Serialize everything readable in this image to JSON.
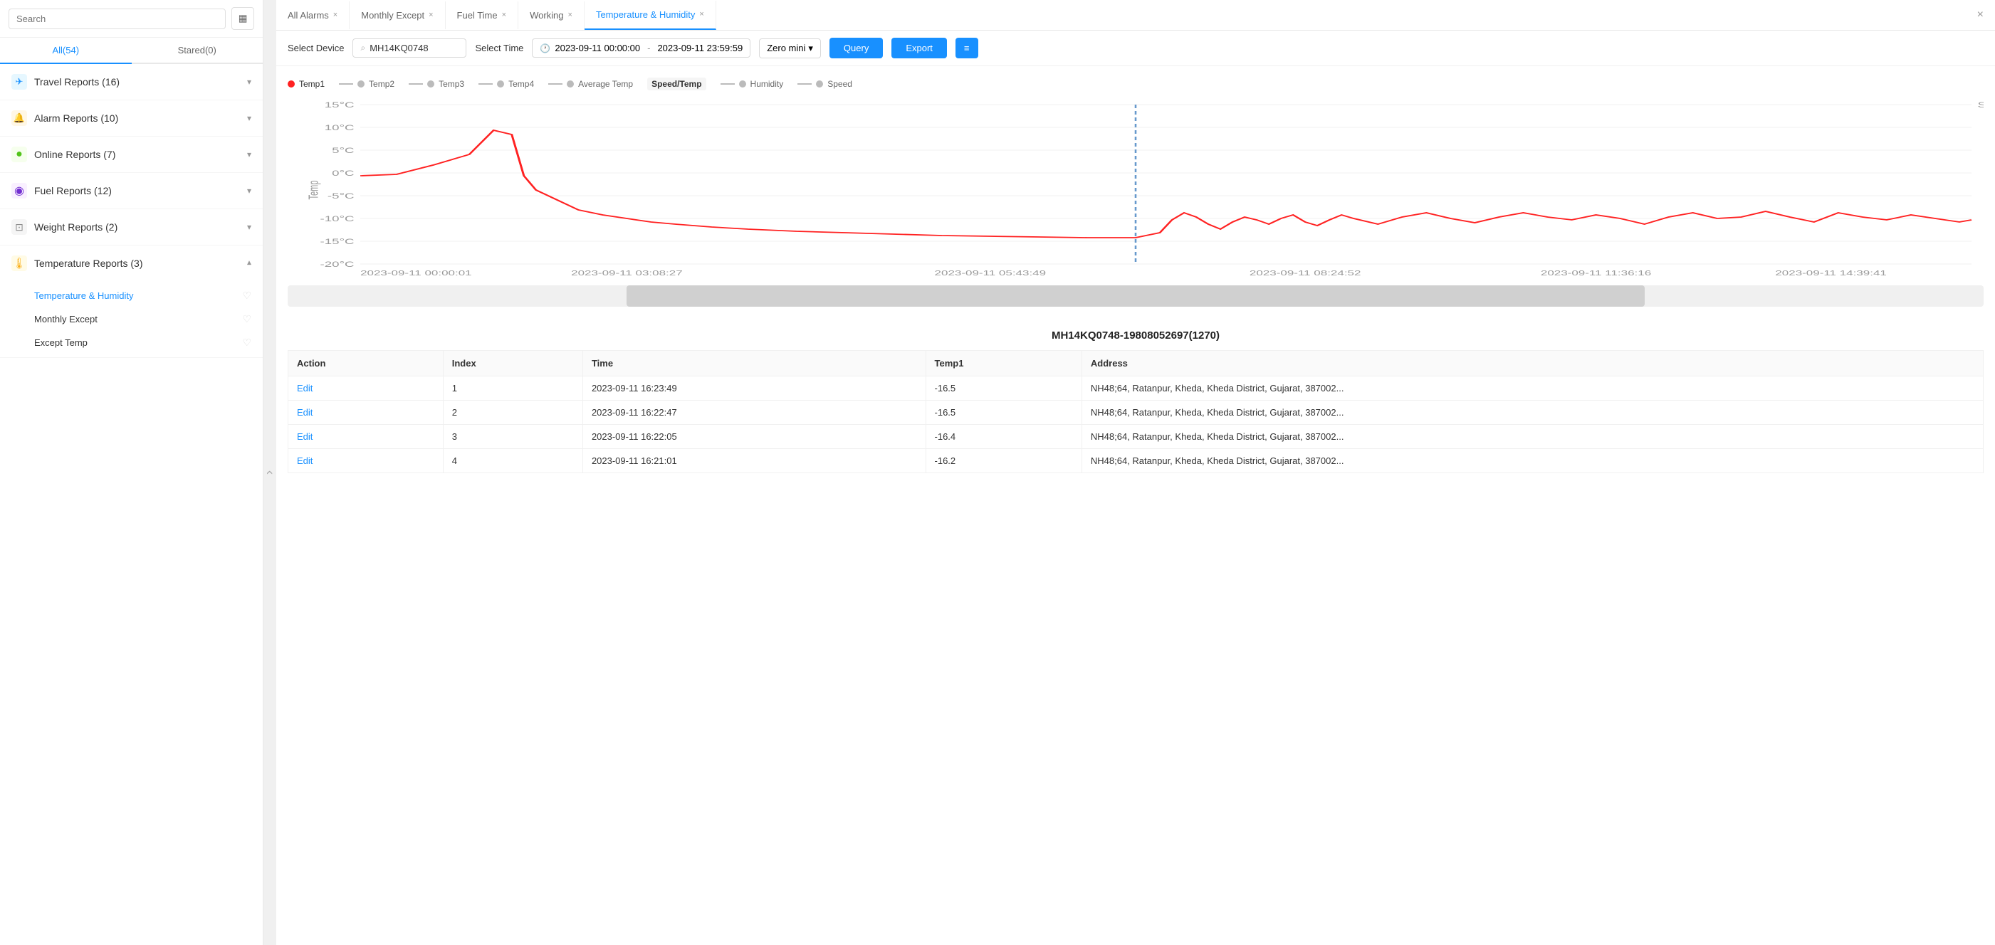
{
  "sidebar": {
    "search_placeholder": "Search",
    "tabs": [
      {
        "id": "all",
        "label": "All(54)",
        "active": true
      },
      {
        "id": "stared",
        "label": "Stared(0)",
        "active": false
      }
    ],
    "categories": [
      {
        "id": "travel",
        "icon": "✈",
        "icon_class": "blue",
        "label": "Travel Reports (16)",
        "expanded": false,
        "items": []
      },
      {
        "id": "alarm",
        "icon": "🔔",
        "icon_class": "orange",
        "label": "Alarm Reports (10)",
        "expanded": false,
        "items": []
      },
      {
        "id": "online",
        "icon": "○",
        "icon_class": "green",
        "label": "Online Reports (7)",
        "expanded": false,
        "items": []
      },
      {
        "id": "fuel",
        "icon": "◉",
        "icon_class": "purple",
        "label": "Fuel Reports (12)",
        "expanded": false,
        "items": []
      },
      {
        "id": "weight",
        "icon": "⊡",
        "icon_class": "gray",
        "label": "Weight Reports (2)",
        "expanded": false,
        "items": []
      },
      {
        "id": "temperature",
        "icon": "🌡",
        "icon_class": "yellow",
        "label": "Temperature Reports (3)",
        "expanded": true,
        "items": [
          {
            "id": "temp-humidity",
            "label": "Temperature & Humidity",
            "active": true
          },
          {
            "id": "monthly-except",
            "label": "Monthly Except",
            "active": false
          },
          {
            "id": "except-temp",
            "label": "Except Temp",
            "active": false
          }
        ]
      }
    ]
  },
  "tabs": [
    {
      "id": "all-alarms",
      "label": "All Alarms",
      "active": false,
      "closable": true
    },
    {
      "id": "monthly-except",
      "label": "Monthly Except",
      "active": false,
      "closable": true
    },
    {
      "id": "fuel-time",
      "label": "Fuel Time",
      "active": false,
      "closable": true
    },
    {
      "id": "working",
      "label": "Working",
      "active": false,
      "closable": true
    },
    {
      "id": "temp-humidity",
      "label": "Temperature & Humidity",
      "active": true,
      "closable": true
    }
  ],
  "toolbar": {
    "select_device_label": "Select Device",
    "device_value": "MH14KQ0748",
    "select_time_label": "Select Time",
    "time_start": "2023-09-11 00:00:00",
    "time_end": "2023-09-11 23:59:59",
    "zero_mini_label": "Zero mini",
    "query_label": "Query",
    "export_label": "Export"
  },
  "chart": {
    "legend": [
      {
        "label": "Temp1",
        "color": "#ff2222",
        "active": true
      },
      {
        "label": "Temp2",
        "color": "#aaa"
      },
      {
        "label": "Temp3",
        "color": "#aaa"
      },
      {
        "label": "Temp4",
        "color": "#aaa"
      },
      {
        "label": "Average Temp",
        "color": "#aaa"
      },
      {
        "label": "Speed/Temp",
        "active": true,
        "highlight": true
      },
      {
        "label": "Humidity",
        "color": "#aaa"
      },
      {
        "label": "Speed",
        "color": "#aaa"
      }
    ],
    "y_axis": [
      "15°C",
      "10°C",
      "5°C",
      "0°C",
      "-5°C",
      "-10°C",
      "-15°C",
      "-20°C"
    ],
    "y_axis_right": "Speed",
    "x_axis": [
      "2023-09-11 00:00:01",
      "2023-09-11 03:08:27",
      "2023-09-11 05:43:49",
      "2023-09-11 08:24:52",
      "2023-09-11 11:36:16",
      "2023-09-11 14:39:41"
    ],
    "temp_label": "Temp"
  },
  "table": {
    "title_device": "MH14KQ0748-19808052697",
    "title_count": "(1270)",
    "columns": [
      "Action",
      "Index",
      "Time",
      "Temp1",
      "Address"
    ],
    "rows": [
      {
        "action": "Edit",
        "index": "1",
        "time": "2023-09-11 16:23:49",
        "temp1": "-16.5",
        "address": "NH48;64, Ratanpur, Kheda, Kheda District, Gujarat, 387002..."
      },
      {
        "action": "Edit",
        "index": "2",
        "time": "2023-09-11 16:22:47",
        "temp1": "-16.5",
        "address": "NH48;64, Ratanpur, Kheda, Kheda District, Gujarat, 387002..."
      },
      {
        "action": "Edit",
        "index": "3",
        "time": "2023-09-11 16:22:05",
        "temp1": "-16.4",
        "address": "NH48;64, Ratanpur, Kheda, Kheda District, Gujarat, 387002..."
      },
      {
        "action": "Edit",
        "index": "4",
        "time": "2023-09-11 16:21:01",
        "temp1": "-16.2",
        "address": "NH48;64, Ratanpur, Kheda, Kheda District, Gujarat, 387002..."
      }
    ]
  },
  "icons": {
    "search": "🔍",
    "grid": "▦",
    "chevron_down": "▾",
    "close": "×",
    "heart": "♡",
    "clock": "🕐",
    "collapse": "‹"
  }
}
